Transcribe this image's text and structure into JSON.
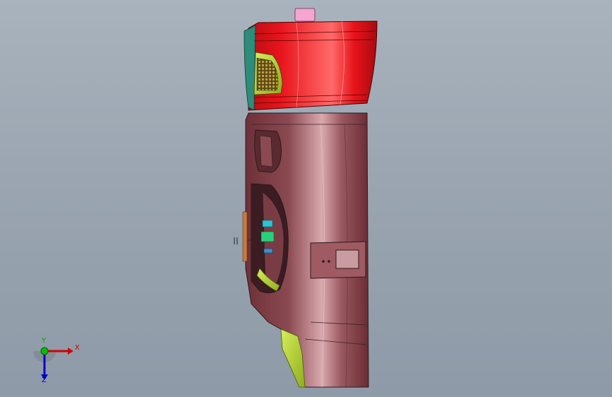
{
  "viewport": {
    "background_top": "#a9b3bd",
    "background_bottom": "#8e9aa7"
  },
  "model": {
    "upper_housing_color": "#e8141b",
    "lower_body_color": "#8b4a52",
    "accent_green": "#b9d832",
    "accent_cyan": "#27c6d6",
    "top_tab_color": "#f2a6d0"
  },
  "triad": {
    "x_label": "X",
    "y_label": "Y",
    "z_label": "Z",
    "x_color": "#d40000",
    "y_color": "#00a000",
    "z_color": "#0000c8"
  }
}
